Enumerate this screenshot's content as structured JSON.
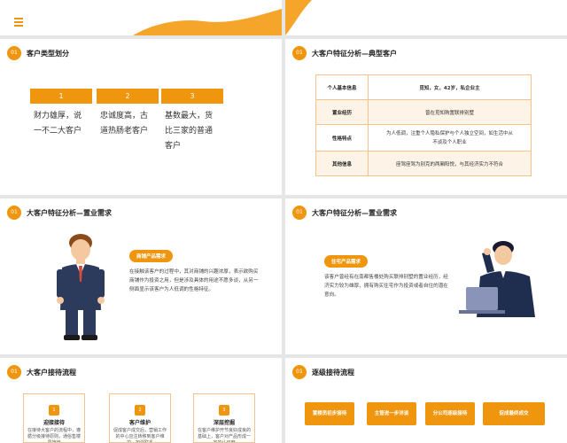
{
  "top": {
    "menu_icon": "hamburger-icon"
  },
  "slide1": {
    "badge": "01",
    "title": "客户类型划分",
    "cards": [
      {
        "num": "1",
        "text": "财力雄厚，说一不二大客户"
      },
      {
        "num": "2",
        "text": "忠诚度高，古道热肠老客户"
      },
      {
        "num": "3",
        "text": "基数最大，货比三家的普通客户"
      }
    ]
  },
  "slide2": {
    "badge": "01",
    "title": "大客户特征分析—典型客户",
    "rows": [
      {
        "key": "个人基本信息",
        "value": "觅知，女，42岁，私企业主"
      },
      {
        "key": "置业经历",
        "value": "曾在觅知购置联排别墅"
      },
      {
        "key": "性格特点",
        "value": "为人低调，注重个人隐私保护与个人独立空间，如生活中从不谈及个人职业"
      },
      {
        "key": "其他信息",
        "value": "座驾座驾为别克的两厢阳悦，与其经济实力不符合"
      }
    ]
  },
  "slide3": {
    "badge": "01",
    "title": "大客户特征分析—置业需求",
    "pill": "商铺产品需求",
    "text": "在接触该客户的过程中，其对商铺的兴趣浓厚，表示欲购买商铺作为投资之用，但是涉及具体的用途不愿多谈，从另一侧面显示该客户为人低调的性格特征。"
  },
  "slide4": {
    "badge": "01",
    "title": "大客户特征分析—置业需求",
    "pill": "住宅产品需求",
    "text": "该客户曾经有在南都售楼处购买联排别墅的置业经历，经济实力较为雄厚，拥有购买住宅作为投资或者自住的潜在意向。"
  },
  "slide5": {
    "badge": "01",
    "title": "大客户接待流程",
    "steps": [
      {
        "num": "1",
        "title": "迎接接待",
        "desc": "在接待大客户的流程中，遵循分级接待原则，通俗售楼员接待"
      },
      {
        "num": "2",
        "title": "客户维护",
        "desc": "促成客户成交后，营销工作的中心应注转移到客户维护，加强联系"
      },
      {
        "num": "3",
        "title": "深层挖掘",
        "desc": "在客户维护开节良好成良的基础上，客户对产品形成一定的认可度"
      }
    ]
  },
  "slide6": {
    "badge": "01",
    "title": "逐级接待流程",
    "buttons": [
      "置楼员初步接待",
      "主管进一步详谈",
      "分公司逐级接待",
      "促成最终成交"
    ]
  }
}
